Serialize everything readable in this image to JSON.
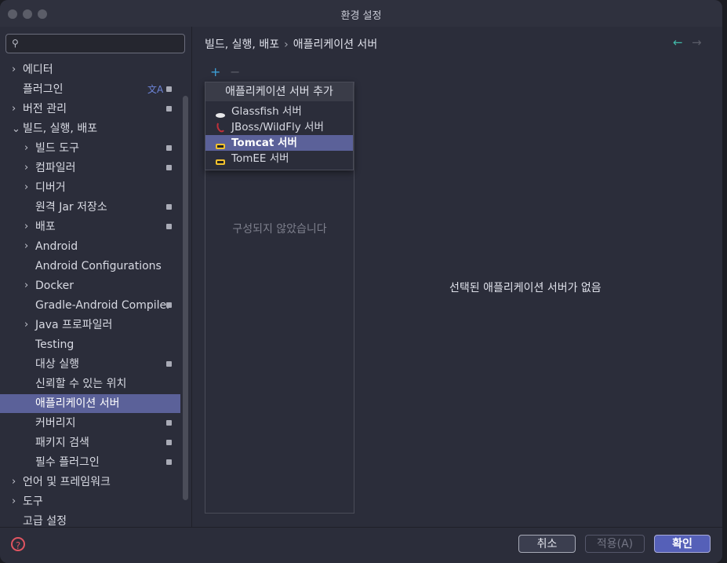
{
  "window": {
    "title": "환경 설정"
  },
  "sidebar": {
    "search_placeholder": "",
    "items": [
      {
        "label": "에디터",
        "level": 0,
        "expander": "collapsed",
        "badge": false,
        "translate": false,
        "selected": false
      },
      {
        "label": "플러그인",
        "level": 0,
        "expander": "none",
        "badge": true,
        "translate": true,
        "selected": false
      },
      {
        "label": "버전 관리",
        "level": 0,
        "expander": "collapsed",
        "badge": true,
        "translate": false,
        "selected": false
      },
      {
        "label": "빌드, 실행, 배포",
        "level": 0,
        "expander": "expanded",
        "badge": false,
        "translate": false,
        "selected": false
      },
      {
        "label": "빌드 도구",
        "level": 1,
        "expander": "collapsed",
        "badge": true,
        "translate": false,
        "selected": false
      },
      {
        "label": "컴파일러",
        "level": 1,
        "expander": "collapsed",
        "badge": true,
        "translate": false,
        "selected": false
      },
      {
        "label": "디버거",
        "level": 1,
        "expander": "collapsed",
        "badge": false,
        "translate": false,
        "selected": false
      },
      {
        "label": "원격 Jar 저장소",
        "level": 1,
        "expander": "none",
        "badge": true,
        "translate": false,
        "selected": false
      },
      {
        "label": "배포",
        "level": 1,
        "expander": "collapsed",
        "badge": true,
        "translate": false,
        "selected": false
      },
      {
        "label": "Android",
        "level": 1,
        "expander": "collapsed",
        "badge": false,
        "translate": false,
        "selected": false
      },
      {
        "label": "Android Configurations",
        "level": 1,
        "expander": "none",
        "badge": false,
        "translate": false,
        "selected": false
      },
      {
        "label": "Docker",
        "level": 1,
        "expander": "collapsed",
        "badge": false,
        "translate": false,
        "selected": false
      },
      {
        "label": "Gradle-Android Compiler",
        "level": 1,
        "expander": "none",
        "badge": true,
        "translate": false,
        "selected": false
      },
      {
        "label": "Java 프로파일러",
        "level": 1,
        "expander": "collapsed",
        "badge": false,
        "translate": false,
        "selected": false
      },
      {
        "label": "Testing",
        "level": 1,
        "expander": "none",
        "badge": false,
        "translate": false,
        "selected": false
      },
      {
        "label": "대상 실행",
        "level": 1,
        "expander": "none",
        "badge": true,
        "translate": false,
        "selected": false
      },
      {
        "label": "신뢰할 수 있는 위치",
        "level": 1,
        "expander": "none",
        "badge": false,
        "translate": false,
        "selected": false
      },
      {
        "label": "애플리케이션 서버",
        "level": 1,
        "expander": "none",
        "badge": false,
        "translate": false,
        "selected": true
      },
      {
        "label": "커버리지",
        "level": 1,
        "expander": "none",
        "badge": true,
        "translate": false,
        "selected": false
      },
      {
        "label": "패키지 검색",
        "level": 1,
        "expander": "none",
        "badge": true,
        "translate": false,
        "selected": false
      },
      {
        "label": "필수 플러그인",
        "level": 1,
        "expander": "none",
        "badge": true,
        "translate": false,
        "selected": false
      },
      {
        "label": "언어 및 프레임워크",
        "level": 0,
        "expander": "collapsed",
        "badge": false,
        "translate": false,
        "selected": false
      },
      {
        "label": "도구",
        "level": 0,
        "expander": "collapsed",
        "badge": false,
        "translate": false,
        "selected": false
      },
      {
        "label": "고급 설정",
        "level": 0,
        "expander": "none",
        "badge": false,
        "translate": false,
        "selected": false
      }
    ]
  },
  "content": {
    "breadcrumb": [
      "빌드, 실행, 배포",
      "애플리케이션 서버"
    ],
    "breadcrumb_sep": "›",
    "empty_list_text": "구성되지 않았습니다",
    "empty_detail_text": "선택된 애플리케이션 서버가 없음"
  },
  "popup": {
    "title": "애플리케이션 서버 추가",
    "items": [
      {
        "label": "Glassfish 서버",
        "icon": "glassfish-icon",
        "selected": false
      },
      {
        "label": "JBoss/WildFly 서버",
        "icon": "jboss-icon",
        "selected": false
      },
      {
        "label": "Tomcat 서버",
        "icon": "tomcat-icon",
        "selected": true
      },
      {
        "label": "TomEE 서버",
        "icon": "tomee-icon",
        "selected": false
      }
    ]
  },
  "buttons": {
    "cancel": "취소",
    "apply": "적용(A)",
    "ok": "확인"
  },
  "icons": {
    "plus": "+",
    "minus": "−",
    "back": "←",
    "forward": "→",
    "help": "?",
    "search": "⚲"
  },
  "colors": {
    "accent": "#5b6199",
    "ok_button": "#5560b8",
    "help": "#e05561",
    "nav_back": "#42b8a8"
  }
}
